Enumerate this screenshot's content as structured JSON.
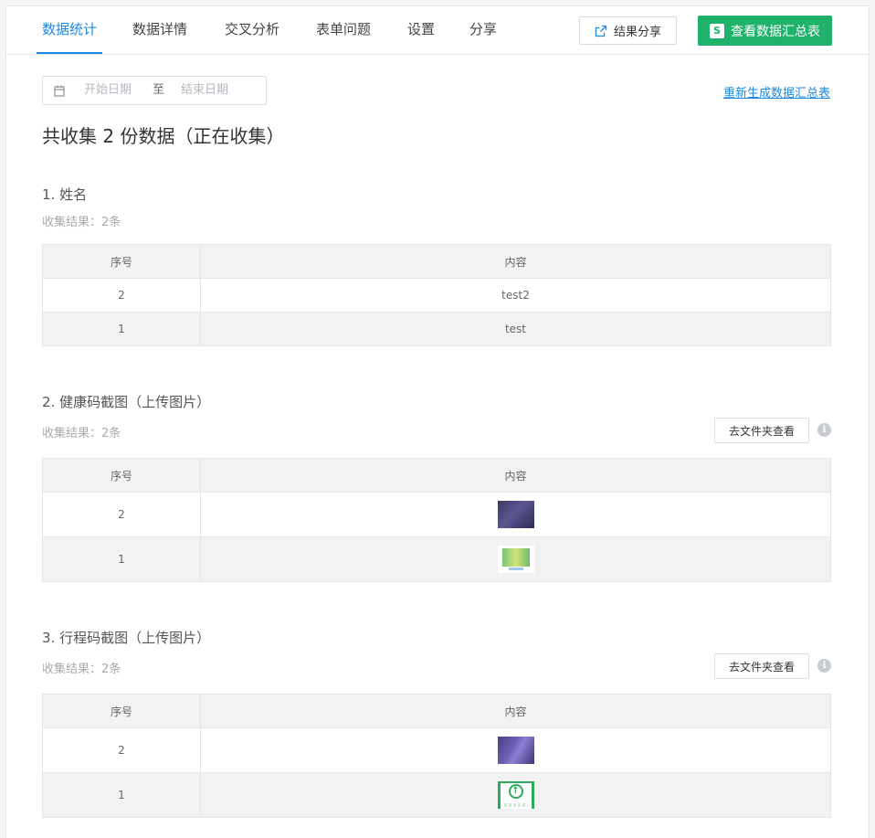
{
  "nav": {
    "tabs": [
      {
        "label": "数据统计",
        "active": true
      },
      {
        "label": "数据详情",
        "active": false
      },
      {
        "label": "交叉分析",
        "active": false
      },
      {
        "label": "表单问题",
        "active": false
      },
      {
        "label": "设置",
        "active": false
      },
      {
        "label": "分享",
        "active": false
      }
    ],
    "share_result_label": "结果分享",
    "view_summary_label": "查看数据汇总表",
    "summary_icon_text": "S",
    "accent_color": "#1e88e5",
    "summary_color": "#20b26b"
  },
  "filter": {
    "start_placeholder": "开始日期",
    "separator": "至",
    "end_placeholder": "结束日期",
    "regenerate_label": "重新生成数据汇总表"
  },
  "summary": {
    "total_text": "共收集 2 份数据（正在收集）"
  },
  "questions": [
    {
      "title": "1.  姓名",
      "result": "收集结果：2条",
      "headers": [
        "序号",
        "内容"
      ],
      "rows": [
        {
          "seq": "2",
          "content": "test2"
        },
        {
          "seq": "1",
          "content": "test"
        }
      ]
    },
    {
      "title": "2.  健康码截图（上传图片）",
      "result": "收集结果：2条",
      "folder_label": "去文件夹查看",
      "info_icon_text": "i",
      "headers": [
        "序号",
        "内容"
      ],
      "rows": [
        {
          "seq": "2",
          "content_image": "dark-photo-thumbnail"
        },
        {
          "seq": "1",
          "content_image": "green-health-code-thumbnail"
        }
      ]
    },
    {
      "title": "3.  行程码截图（上传图片）",
      "result": "收集结果：2条",
      "folder_label": "去文件夹查看",
      "info_icon_text": "i",
      "headers": [
        "序号",
        "内容"
      ],
      "rows": [
        {
          "seq": "2",
          "content_image": "purple-photo-thumbnail"
        },
        {
          "seq": "1",
          "content_image": "trip-code-thumbnail",
          "arrow_glyph": "↑"
        }
      ]
    }
  ]
}
